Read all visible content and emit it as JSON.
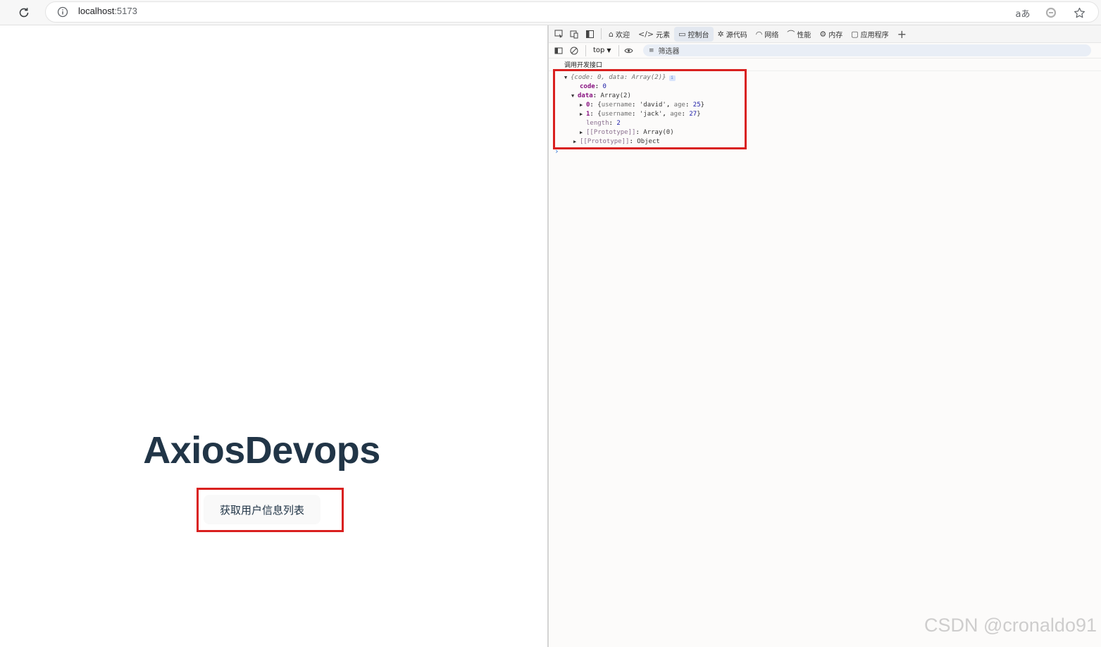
{
  "browser": {
    "url_host": "localhost",
    "url_port": ":5173",
    "translate_icon_label": "aあ"
  },
  "page": {
    "title": "AxiosDevops",
    "button_label": "获取用户信息列表"
  },
  "devtools": {
    "tabs": [
      {
        "label": "欢迎",
        "icon": "home-icon"
      },
      {
        "label": "元素",
        "icon": "code-icon"
      },
      {
        "label": "控制台",
        "icon": "console-icon"
      },
      {
        "label": "源代码",
        "icon": "bug-icon"
      },
      {
        "label": "网络",
        "icon": "wifi-icon"
      },
      {
        "label": "性能",
        "icon": "gauge-icon"
      },
      {
        "label": "内存",
        "icon": "gear-icon"
      },
      {
        "label": "应用程序",
        "icon": "window-icon"
      }
    ],
    "active_tab": "控制台",
    "context": "top",
    "filter_placeholder": "筛选器",
    "log_message": "调用开发接口",
    "object": {
      "preview_open": "{",
      "preview_code_key": "code",
      "preview_code_val": "0",
      "preview_data_key": "data",
      "preview_data_val": "Array(2)",
      "preview_close": "}",
      "code_key": "code",
      "code_val": "0",
      "data_key": "data",
      "data_val": "Array(2)",
      "items": [
        {
          "index": "0",
          "username": "'david'",
          "age": "25"
        },
        {
          "index": "1",
          "username": "'jack'",
          "age": "27"
        }
      ],
      "length_key": "length",
      "length_val": "2",
      "proto_array_key": "[[Prototype]]",
      "proto_array_val": "Array(0)",
      "proto_obj_key": "[[Prototype]]",
      "proto_obj_val": "Object"
    }
  },
  "watermark": "CSDN @cronaldo91",
  "colors": {
    "highlight": "#d9201f",
    "title": "#213547",
    "prompt": "#3f7bd6"
  }
}
